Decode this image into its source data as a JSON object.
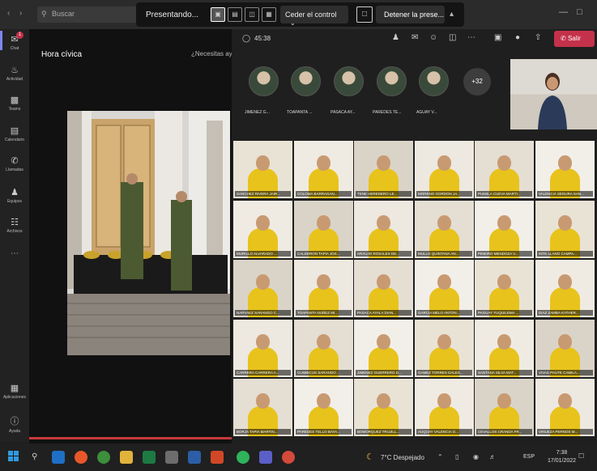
{
  "titlebar": {
    "search_placeholder": "Buscar",
    "back_icon": "chevron-left-icon",
    "forward_icon": "chevron-right-icon"
  },
  "share_toolbar": {
    "presenting_label": "Presentando...",
    "give_control_label": "Ceder el control",
    "stop_presenting_label": "Detener la prese..."
  },
  "rail": {
    "items": [
      {
        "label": "Chat",
        "icon": "chat-icon",
        "badge": "1"
      },
      {
        "label": "Actividad",
        "icon": "bell-icon"
      },
      {
        "label": "Teams",
        "icon": "teams-icon"
      },
      {
        "label": "Calendario",
        "icon": "calendar-icon"
      },
      {
        "label": "Llamadas",
        "icon": "phone-icon"
      },
      {
        "label": "Equipos",
        "icon": "people-icon"
      },
      {
        "label": "Archivos",
        "icon": "file-icon"
      }
    ],
    "apps_label": "Aplicaciones",
    "help_label": "Ayuda"
  },
  "share": {
    "title": "Hora cívica",
    "help_link": "¿Necesitas ayuda?"
  },
  "meeting": {
    "timer": "45:38",
    "leave_label": "Salir",
    "more_count": "+32",
    "top_participants": [
      "JIMENEZ G...",
      "TOAPANTA ...",
      "PASACA AY...",
      "PAREDES TE...",
      "AGUAY V..."
    ],
    "grid": [
      [
        "SANCHEZ RIVERA JAIR...",
        "COLOMA BARRAGAN...",
        "TENE HEREDERO LE...",
        "MORENO GORDON JA...",
        "PUEBLA CUEVA MARTI...",
        "VALENCIA SEGURA SAN..."
      ],
      [
        "MURILLO ALVARADO ...",
        "CALDERON TAPIA JOS...",
        "ARAUJO ROSALES DE...",
        "MULLO QUINTANA AN...",
        "PINEIRO MENDOZA V...",
        "INTE LLANO CAMPA..."
      ],
      [
        "NARVAEZ SARANGO C...",
        "TOAPANTA NUÑEZ MI...",
        "PASACA AYALA DIAN...",
        "GARCIA MELO ANTON...",
        "PAGUAY YUQUILEMA ...",
        "DIAZ ZAMBA KATHER..."
      ],
      [
        "CARRERA CARRERA A...",
        "CUMBICUS SARANGO ...",
        "JIMENEZ GUERRERO D...",
        "GAMEZ TORRES DALEX...",
        "SANTANA SILVA MAT...",
        "VIVAS PAUTE CAMILA..."
      ],
      [
        "BORJA TAPIA MARTIN...",
        "PAREDES TELLO BAYA...",
        "BOMORQUEZ TRUJILL...",
        "AUQUAY VALENCIA G...",
        "CEVALLOS CRANDA FR...",
        "VINUEZA PERNOS M..."
      ]
    ]
  },
  "taskbar": {
    "weather_temp": "7°C",
    "weather_desc": "Despejado",
    "language": "ESP",
    "time": "7:38",
    "date": "17/01/2022"
  },
  "colors": {
    "accent": "#7f85f5",
    "leave": "#c4314b",
    "uniform": "#e8c31c"
  }
}
